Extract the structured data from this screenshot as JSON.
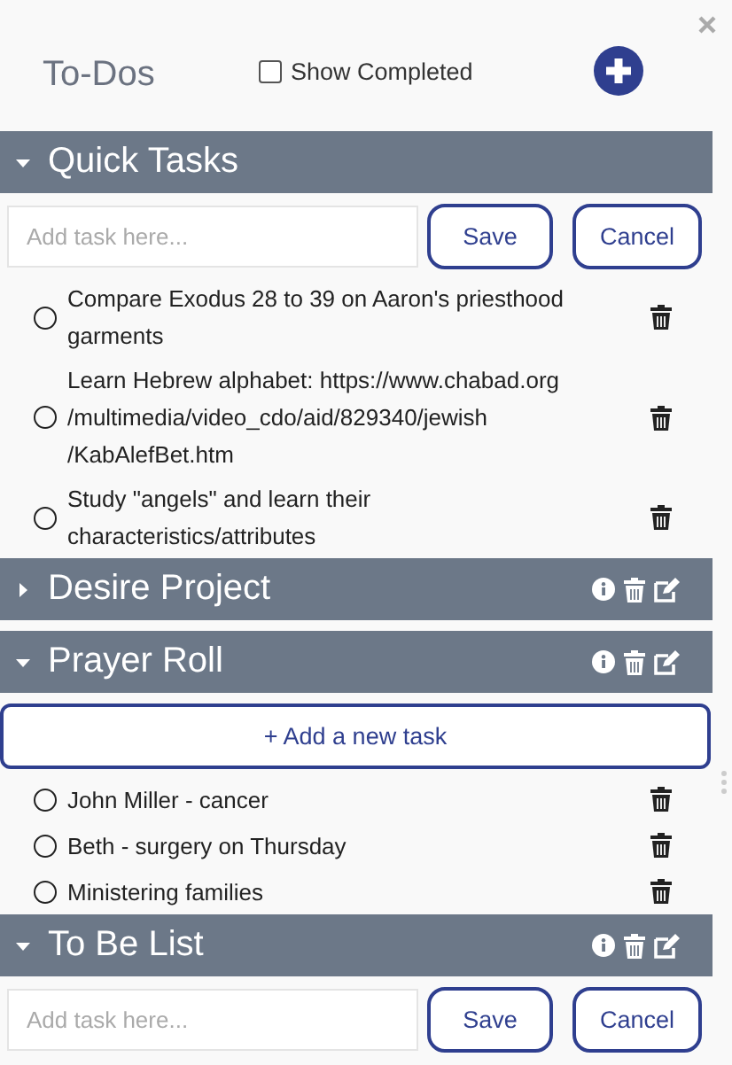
{
  "title": "To-Dos",
  "show_completed": {
    "label": "Show Completed",
    "checked": false
  },
  "sections": [
    {
      "title": "Quick Tasks",
      "kind": "builtin",
      "expanded": true,
      "body": {
        "kind": "composer",
        "placeholder": "Add task here...",
        "buttons": [
          "Save",
          "Cancel"
        ]
      },
      "tasks": [
        {
          "text": "Compare Exodus 28 to 39 on Aaron's priesthood garments",
          "completed": false
        },
        {
          "text": "Learn Hebrew alphabet: https://www.chabad.org /multimedia/video_cdo/aid/829340/jewish /KabAlefBet.htm",
          "completed": false
        },
        {
          "text": "Study \"angels\" and learn their characteristics/attributes",
          "completed": false
        }
      ]
    },
    {
      "title": "Desire Project",
      "kind": "custom",
      "expanded": false
    },
    {
      "title": "Prayer Roll",
      "kind": "custom",
      "expanded": true,
      "body": {
        "kind": "add_button",
        "label": "+ Add a new task"
      },
      "tasks": [
        {
          "text": "John Miller - cancer",
          "completed": false
        },
        {
          "text": "Beth - surgery on Thursday",
          "completed": false
        },
        {
          "text": "Ministering families",
          "completed": false
        }
      ]
    },
    {
      "title": "To Be List",
      "kind": "custom",
      "expanded": true,
      "body": {
        "kind": "composer",
        "placeholder": "Add task here...",
        "buttons": [
          "Save",
          "Cancel"
        ]
      }
    }
  ]
}
